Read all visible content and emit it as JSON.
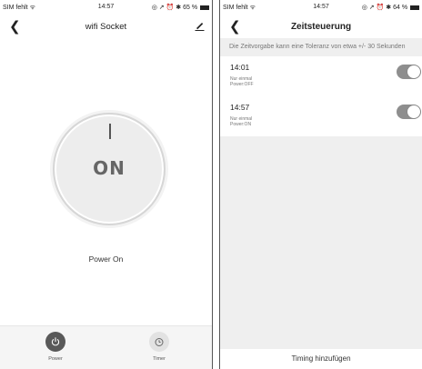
{
  "colors": {
    "dial_face": "#ededed",
    "power_tab_active": "#595959",
    "toggle_on": "#8e8e8e",
    "hint_bg": "#efefef"
  },
  "left": {
    "status": {
      "carrier": "SIM fehlt ᯤ",
      "time": "14:57",
      "indicators": "◎ ↗ ⏰ ✱ 65 %"
    },
    "nav": {
      "back_icon": "chevron-left-icon",
      "title": "wifi Socket",
      "edit_icon": "pencil-icon"
    },
    "dial": {
      "state": "ON"
    },
    "power_status": "Power On",
    "tabs": [
      {
        "label": "Power",
        "icon": "power-icon",
        "active": true
      },
      {
        "label": "Timer",
        "icon": "timer-icon",
        "active": false
      }
    ]
  },
  "right": {
    "status": {
      "carrier": "SIM fehlt ᯤ",
      "time": "14:57",
      "indicators": "◎ ↗ ⏰ ✱ 64 %"
    },
    "nav": {
      "back_icon": "chevron-left-icon",
      "title": "Zeitsteuerung"
    },
    "hint": "Die Zeitvorgabe kann eine Toleranz von etwa +/- 30 Sekunden",
    "timers": [
      {
        "time": "14:01",
        "repeat": "Nur einmal",
        "action": "Power:OFF",
        "enabled": true
      },
      {
        "time": "14:57",
        "repeat": "Nur einmal",
        "action": "Power:ON",
        "enabled": true
      }
    ],
    "add_button": "Timing hinzufügen"
  }
}
